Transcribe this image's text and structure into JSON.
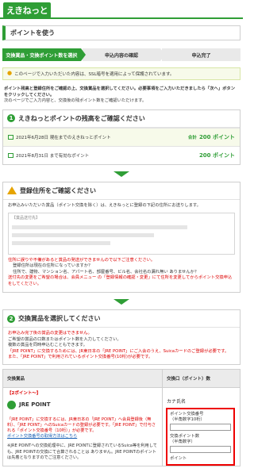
{
  "header": {
    "logo": "えきねっと"
  },
  "page": {
    "title": "ポイントを使う"
  },
  "steps": [
    {
      "label": "交換賞品・交換ポイント数を選択"
    },
    {
      "label": "申込内容の確認"
    },
    {
      "label": "申込完了"
    }
  ],
  "notice": "このページで入力いただいた内容は、SSL暗号を適用によって保護されています。",
  "intro": [
    "ポイント残高と登録住所をご確認の上、交換賞品を選択してください。必要事項をご入力いただきましたら「次へ」ボタンをクリックしてください。",
    "次のページでご入力内容と、交換後の残ポイント数をご確認いただけます。"
  ],
  "balance": {
    "heading": "えきねっとポイントの残高をご確認ください",
    "rows": [
      {
        "label": "2021年6月28日 現在までのえきねっとポイント",
        "prefix": "合計",
        "value": "200 ポイント"
      },
      {
        "label": "2021年8月31日 まで有効なポイント",
        "prefix": "",
        "value": "200 ポイント"
      }
    ]
  },
  "address": {
    "heading": "登録住所をご確認ください",
    "lead": "お申込みいただいた賞品（ポイント交換を除く）は、えきねっとに登録の下記の住所にお送りします。",
    "box_label": "【賞品送付先】",
    "red_notes": [
      "住所に誤りや不備があると賞品の発送ができませんので以下ご注意ください。",
      "登録住所は現在の住所になっていますか？",
      "住所で、建物、マンション名、アパート名、部屋番号、ビル名、会社名の漏れ無い ありませんか？",
      "送付先の変更をご希望の場合は、会員メニュー の「登録情報の確認・変更」にて住所を変更してからポイント交換申込をしてください。"
    ],
    "dark_indexes": "1,2"
  },
  "exchange": {
    "heading": "交換賞品を選択してください",
    "notes": [
      "お申込み完了後の賞品の変更はできません。",
      "ご希望の賞品の口数またはポイント数を入力してください。",
      "複数の賞品を同時申込むこともできます。",
      "「JRE POINT」に交換するためには、JR東日本の「JRE POINT」にご入会のうえ、Suicaカードのご登録が必要です。",
      "また、「JRE POINT」で利用されているポイント交換番号(10桁)が必要です。"
    ]
  },
  "table": {
    "col1_header": "交換賞品",
    "col2_header": "交換口（ポイント）数",
    "item": {
      "caption": "【2ポイント〜】",
      "name": "JRE POINT",
      "text_red": "「JRE POINT」に交換するには、JR東日本の「JRE POINT」へ会員登録後（無料）、「JRE POINT」へのSuicaカードの登録が必要です。「JRE POINT」で付与される「ポイント交換番号（10桁）」が必要です。",
      "link": "ポイント交換番号の取得方法はこちら",
      "text": "※JRE POINTへの交換処理中に、JRE POINTに登録されているSuica等を利用しても、JRE POINTの交換にて合算されることは ありません。JRE POINTのポイントは先着となりますのでご注意ください。"
    },
    "kana": "カナ氏名",
    "form": {
      "exchange_no_label": "ポイント交換番号",
      "exchange_no_sub": "（半角数字10桁）",
      "points_label": "交換ポイント数",
      "points_sub": "（半角数字）",
      "unit": "ポイント"
    }
  }
}
